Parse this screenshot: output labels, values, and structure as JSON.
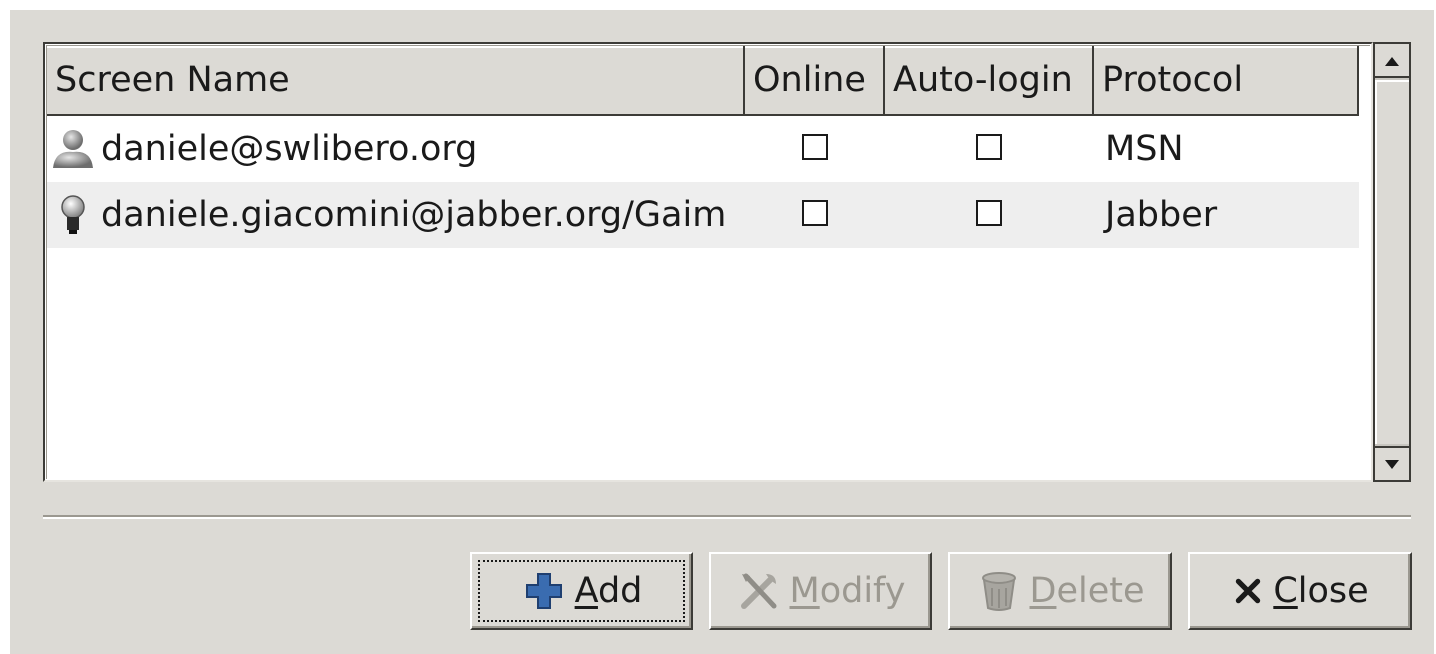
{
  "columns": {
    "screen_name": "Screen Name",
    "online": "Online",
    "auto_login": "Auto-login",
    "protocol": "Protocol"
  },
  "accounts": [
    {
      "screen_name": "daniele@swlibero.org",
      "online": false,
      "auto_login": false,
      "protocol": "MSN",
      "icon": "msn-buddy-icon"
    },
    {
      "screen_name": "daniele.giacomini@jabber.org/Gaim",
      "online": false,
      "auto_login": false,
      "protocol": "Jabber",
      "icon": "jabber-lightbulb-icon"
    }
  ],
  "buttons": {
    "add": {
      "mnemonic": "A",
      "rest": "dd",
      "icon": "plus-icon",
      "enabled": true,
      "focused": true
    },
    "modify": {
      "mnemonic": "M",
      "rest": "odify",
      "icon": "tools-icon",
      "enabled": false
    },
    "delete": {
      "mnemonic": "D",
      "rest": "elete",
      "icon": "trash-icon",
      "enabled": false
    },
    "close": {
      "mnemonic": "C",
      "rest": "lose",
      "icon": "close-x-icon",
      "enabled": true
    }
  },
  "colors": {
    "window_bg": "#dcdad5",
    "list_bg": "#ffffff",
    "alt_row_bg": "#eeeeee",
    "plus_blue": "#3a6cb0",
    "disabled_text": "#9b9890"
  }
}
